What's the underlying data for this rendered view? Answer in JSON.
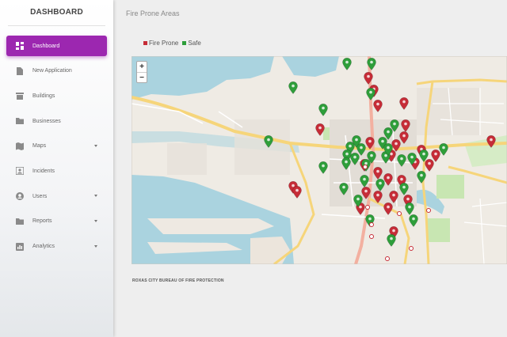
{
  "sidebar": {
    "brand": "DASHBOARD",
    "items": [
      {
        "label": "Dashboard",
        "icon": "dashboard-icon",
        "active": true,
        "has_submenu": false
      },
      {
        "label": "New Application",
        "icon": "file-icon",
        "active": false,
        "has_submenu": false
      },
      {
        "label": "Buildings",
        "icon": "building-icon",
        "active": false,
        "has_submenu": false
      },
      {
        "label": "Businesses",
        "icon": "folder-icon",
        "active": false,
        "has_submenu": false
      },
      {
        "label": "Maps",
        "icon": "map-icon",
        "active": false,
        "has_submenu": true
      },
      {
        "label": "Incidents",
        "icon": "incident-icon",
        "active": false,
        "has_submenu": false
      },
      {
        "label": "Users",
        "icon": "user-icon",
        "active": false,
        "has_submenu": true
      },
      {
        "label": "Reports",
        "icon": "reports-folder-icon",
        "active": false,
        "has_submenu": true
      },
      {
        "label": "Analytics",
        "icon": "analytics-icon",
        "active": false,
        "has_submenu": true
      }
    ]
  },
  "main": {
    "title": "Fire Prone Areas",
    "legend": [
      {
        "label": "Fire Prone",
        "color": "#c62c37"
      },
      {
        "label": "Safe",
        "color": "#2e9e3a"
      }
    ],
    "zoom": {
      "in": "+",
      "out": "−"
    },
    "footer": "ROXAS CITY BUREAU OF FIRE PROTECTION"
  },
  "colors": {
    "accent": "#9c27b0",
    "fire_prone": "#c62c37",
    "safe": "#2e9e3a",
    "water": "#aad3df"
  }
}
